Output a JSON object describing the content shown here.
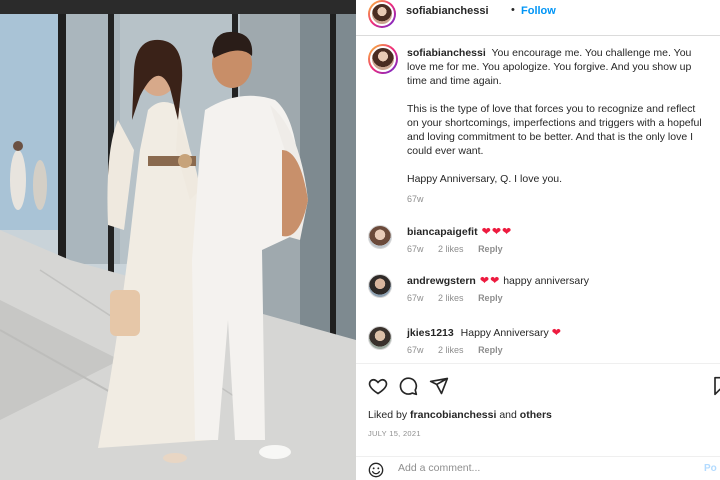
{
  "post": {
    "username": "sofiabianchessi",
    "dot": "•",
    "follow_label": "Follow",
    "caption": {
      "username": "sofiabianchessi",
      "paragraph1": "You encourage me. You challenge me. You love me for me. You apologize. You forgive. And you show up time and time again.",
      "paragraph2": "This is the type of love that forces you to recognize and reflect on your shortcomings, imperfections and triggers with a hopeful and loving commitment to be better. And that is the only love I could ever want.",
      "paragraph3": "Happy Anniversary, Q. I love you.",
      "time": "67w"
    },
    "comments": [
      {
        "username": "biancapaigefit",
        "text": "",
        "hearts": 3,
        "time": "67w",
        "likes": "2 likes",
        "reply": "Reply"
      },
      {
        "username": "andrewgstern",
        "text": "happy anniversary",
        "hearts": 2,
        "time": "67w",
        "likes": "2 likes",
        "reply": "Reply"
      },
      {
        "username": "jkies1213",
        "text": "Happy Anniversary",
        "hearts": 1,
        "time": "67w",
        "likes": "2 likes",
        "reply": "Reply"
      }
    ],
    "actions": {
      "icons": [
        "heart-icon",
        "comment-icon",
        "share-icon",
        "bookmark-icon"
      ],
      "liked_by_prefix": "Liked by",
      "liked_by_user": "francobianchessi",
      "liked_by_and": "and",
      "liked_by_others": "others",
      "date": "JULY 15, 2021"
    },
    "add_comment": {
      "placeholder": "Add a comment...",
      "post_label": "Po"
    }
  },
  "colors": {
    "accent": "#0095f6",
    "heart": "#ed1b3f",
    "muted": "#8e8e8e"
  }
}
